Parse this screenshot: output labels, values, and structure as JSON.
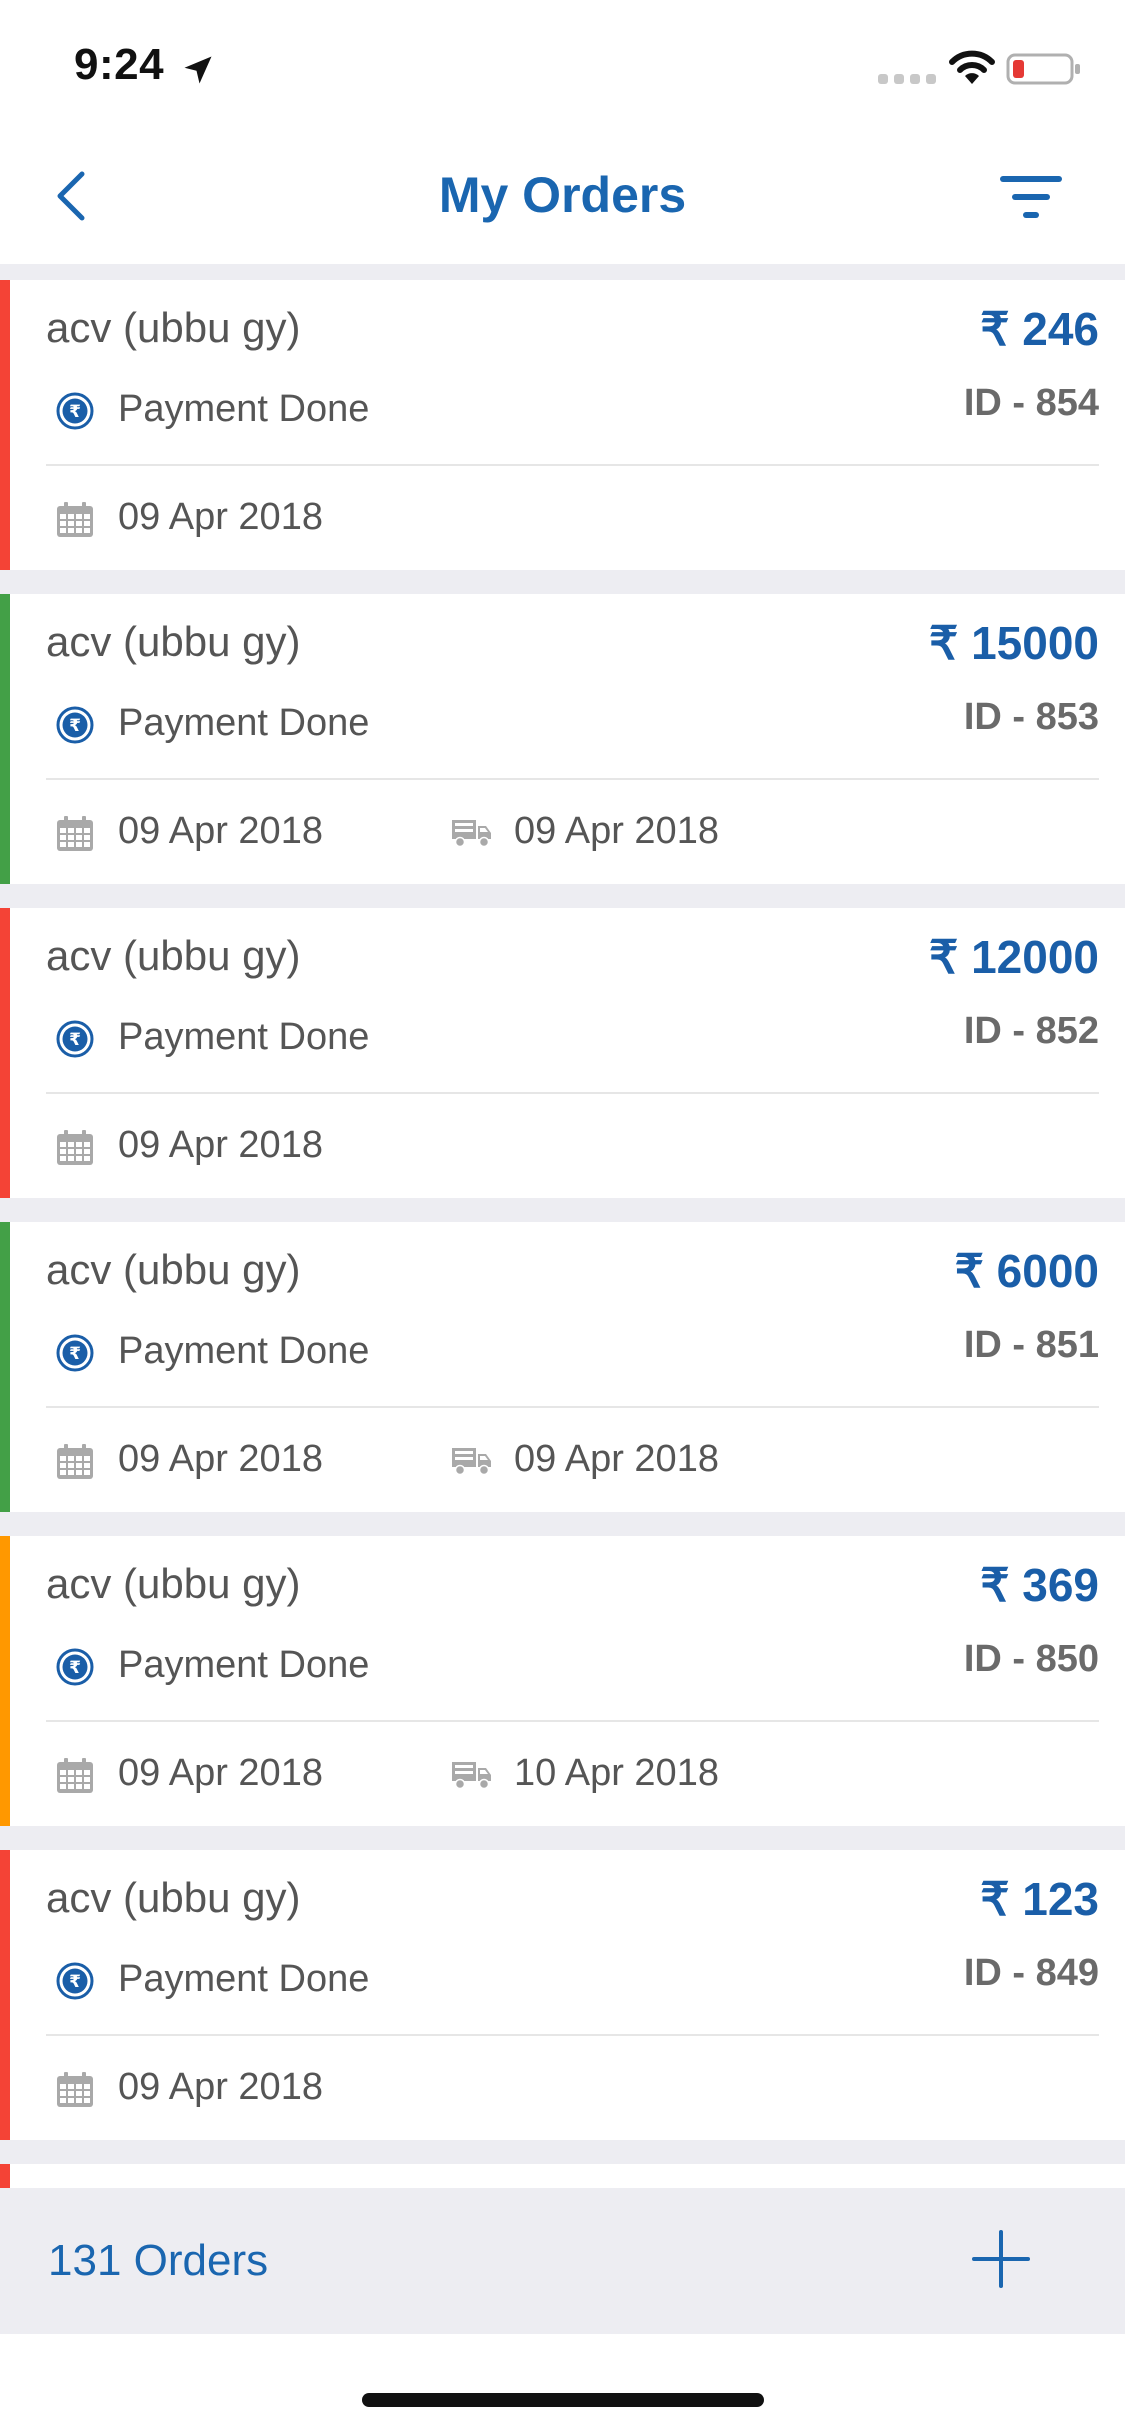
{
  "status_bar": {
    "time": "9:24"
  },
  "nav": {
    "title": "My Orders"
  },
  "colors": {
    "accent": "#1a66b0",
    "stripe_red": "#f44336",
    "stripe_green": "#43a047",
    "stripe_orange": "#ff9800"
  },
  "orders": [
    {
      "customer": "acv (ubbu gy)",
      "amount": "₹ 246",
      "payment_status": "Payment Done",
      "id": "ID - 854",
      "order_date": "09 Apr 2018",
      "delivery_date": "",
      "stripe": "red"
    },
    {
      "customer": "acv (ubbu gy)",
      "amount": "₹ 15000",
      "payment_status": "Payment Done",
      "id": "ID - 853",
      "order_date": "09 Apr 2018",
      "delivery_date": "09 Apr 2018",
      "stripe": "green"
    },
    {
      "customer": "acv (ubbu gy)",
      "amount": "₹ 12000",
      "payment_status": "Payment Done",
      "id": "ID - 852",
      "order_date": "09 Apr 2018",
      "delivery_date": "",
      "stripe": "red"
    },
    {
      "customer": "acv (ubbu gy)",
      "amount": "₹ 6000",
      "payment_status": "Payment Done",
      "id": "ID - 851",
      "order_date": "09 Apr 2018",
      "delivery_date": "09 Apr 2018",
      "stripe": "green"
    },
    {
      "customer": "acv (ubbu gy)",
      "amount": "₹ 369",
      "payment_status": "Payment Done",
      "id": "ID - 850",
      "order_date": "09 Apr 2018",
      "delivery_date": "10 Apr 2018",
      "stripe": "orange"
    },
    {
      "customer": "acv (ubbu gy)",
      "amount": "₹ 123",
      "payment_status": "Payment Done",
      "id": "ID - 849",
      "order_date": "09 Apr 2018",
      "delivery_date": "",
      "stripe": "red"
    }
  ],
  "footer": {
    "orders_count": "131 Orders"
  }
}
